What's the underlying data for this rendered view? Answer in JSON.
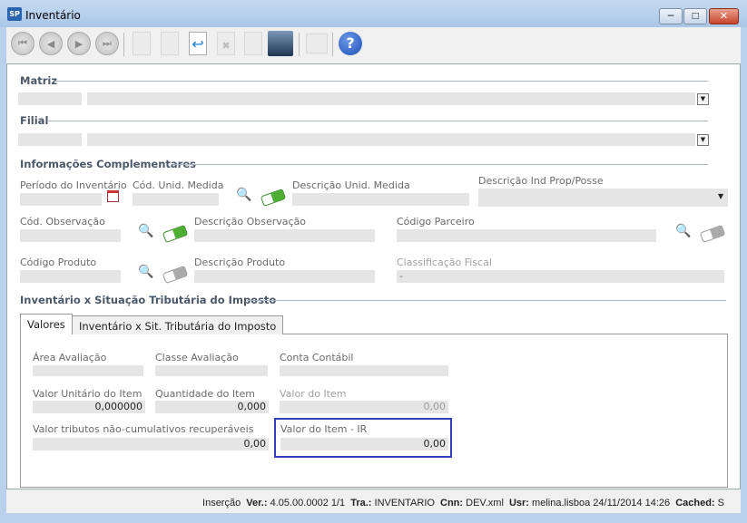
{
  "window": {
    "title": "Inventário",
    "app_icon": "SP",
    "minimize": "─",
    "maximize": "□",
    "close": "✕"
  },
  "toolbar": {
    "buttons": [
      "first-record",
      "previous-record",
      "next-record",
      "last-record",
      "new",
      "edit",
      "undo",
      "delete",
      "redo",
      "save",
      "lock",
      "help"
    ],
    "help_label": "?"
  },
  "matriz": {
    "label": "Matriz"
  },
  "filial": {
    "label": "Filial"
  },
  "complementares": {
    "label": "Informações Complementares",
    "periodo": "Período do Inventário",
    "cod_unid": "Cód. Unid. Medida",
    "desc_unid": "Descrição Unid. Medida",
    "desc_ind": "Descrição Ind Prop/Posse",
    "cod_obs": "Cód. Observação",
    "desc_obs": "Descrição Observação",
    "cod_parceiro": "Código Parceiro",
    "cod_produto": "Código Produto",
    "desc_produto": "Descrição Produto",
    "class_fiscal": "Classificação Fiscal",
    "class_fiscal_value": "-"
  },
  "imposto": {
    "label": "Inventário x Situação Tributária do Imposto",
    "tabs": [
      "Valores",
      "Inventário x Sit. Tributária do Imposto"
    ],
    "area": "Área Avaliação",
    "classe": "Classe Avaliação",
    "conta": "Conta Contábil",
    "valor_unit": "Valor Unitário do Item",
    "valor_unit_value": "0,000000",
    "quantidade": "Quantidade do Item",
    "quantidade_value": "0,000",
    "valor_item": "Valor do Item",
    "valor_item_value": "0,00",
    "tributos": "Valor tributos não-cumulativos recuperáveis",
    "tributos_value": "0,00",
    "valor_ir": "Valor do Item - IR",
    "valor_ir_value": "0,00"
  },
  "status": {
    "mode": "Inserção",
    "ver_label": "Ver.:",
    "ver": "4.05.00.0002  1/1",
    "tra_label": "Tra.:",
    "tra": "INVENTARIO",
    "cnn_label": "Cnn:",
    "cnn": "DEV.xml",
    "usr_label": "Usr:",
    "usr": "melina.lisboa  24/11/2014  14:26",
    "cached_label": "Cached:",
    "cached": "S"
  },
  "colors": {
    "highlight": "#3340b8",
    "help": "#1f4fb8"
  }
}
